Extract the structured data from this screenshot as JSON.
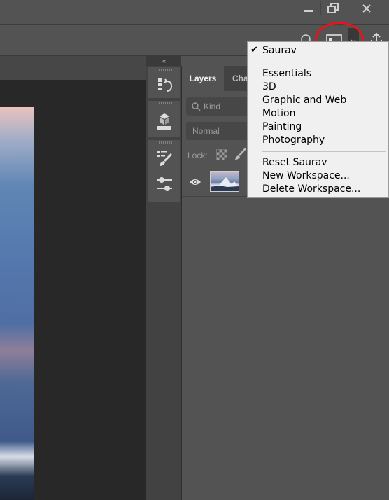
{
  "workspace_menu": {
    "current": "Saurav",
    "presets": [
      "Essentials",
      "3D",
      "Graphic and Web",
      "Motion",
      "Painting",
      "Photography"
    ],
    "actions": [
      "Reset Saurav",
      "New Workspace...",
      "Delete Workspace..."
    ]
  },
  "panels": {
    "collapse_glyph": "‹‹",
    "tabs": [
      "Layers",
      "Cha"
    ]
  },
  "layers": {
    "kind_placeholder": "Kind",
    "blend_mode": "Normal",
    "lock_label": "Lock:"
  },
  "icons": {
    "window": [
      "minimize-icon",
      "restore-icon",
      "close-icon"
    ],
    "options_bar": [
      "search-icon",
      "workspace-icon",
      "chevron-down-icon",
      "share-icon"
    ],
    "dock": [
      "history-icon",
      "3d-icon",
      "brush-settings-icon",
      "adjustments-icon"
    ]
  },
  "colors": {
    "app_background": "#535353",
    "dock_background": "#424242",
    "document_background": "#282828",
    "menu_background": "#f0f0f0",
    "highlight_annotation": "#e8141d"
  }
}
